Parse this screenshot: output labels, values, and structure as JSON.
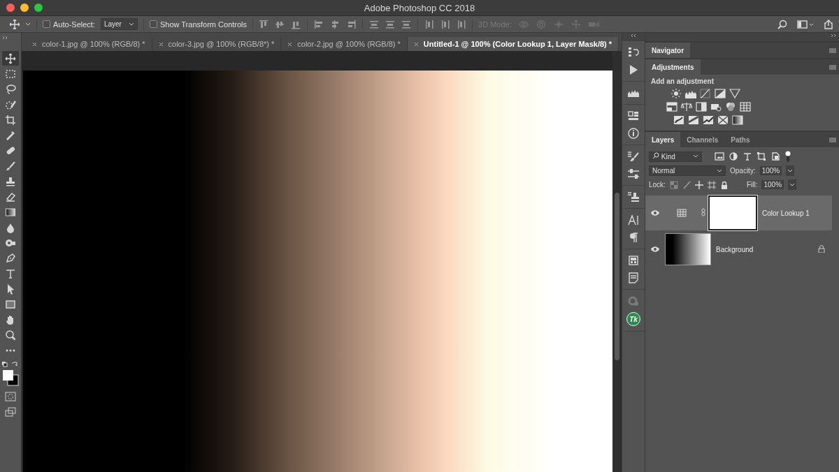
{
  "window": {
    "title": "Adobe Photoshop CC 2018"
  },
  "options_bar": {
    "auto_select": {
      "label": "Auto-Select:",
      "checked": false
    },
    "target": "Layer",
    "show_transform": {
      "label": "Show Transform Controls",
      "checked": false
    },
    "mode_3d": "3D Mode:"
  },
  "document_tabs": [
    {
      "label": "color-1.jpg @ 100% (RGB/8) *",
      "selected": false
    },
    {
      "label": "color-3.jpg @ 100% (RGB/8*) *",
      "selected": false
    },
    {
      "label": "color-2.jpg @ 100% (RGB/8) *",
      "selected": false
    },
    {
      "label": "Untitled-1 @ 100% (Color Lookup 1, Layer Mask/8) *",
      "selected": true
    }
  ],
  "tools": [
    {
      "kind": "move",
      "selected": true
    },
    {
      "kind": "marquee",
      "selected": false
    },
    {
      "kind": "lasso",
      "selected": false
    },
    {
      "kind": "quick-select",
      "selected": false
    },
    {
      "kind": "crop",
      "selected": false
    },
    {
      "kind": "eyedropper",
      "selected": false
    },
    {
      "kind": "healing",
      "selected": false
    },
    {
      "kind": "brush",
      "selected": false
    },
    {
      "kind": "stamp",
      "selected": false
    },
    {
      "kind": "eraser",
      "selected": false
    },
    {
      "kind": "gradient",
      "selected": false
    },
    {
      "kind": "blur",
      "selected": false
    },
    {
      "kind": "dodge",
      "selected": false
    },
    {
      "kind": "pen",
      "selected": false
    },
    {
      "kind": "type",
      "selected": false
    },
    {
      "kind": "path-select",
      "selected": false
    },
    {
      "kind": "rectangle",
      "selected": false
    },
    {
      "kind": "hand",
      "selected": false
    },
    {
      "kind": "zoom",
      "selected": false
    },
    {
      "kind": "more",
      "selected": false
    }
  ],
  "panels": {
    "navigator": {
      "title": "Navigator"
    },
    "adjustments": {
      "title": "Adjustments",
      "subtitle": "Add an adjustment"
    },
    "layers": {
      "tabs": [
        {
          "label": "Layers",
          "selected": true
        },
        {
          "label": "Channels",
          "selected": false
        },
        {
          "label": "Paths",
          "selected": false
        }
      ],
      "filter": "Kind",
      "blend_mode": "Normal",
      "opacity_label": "Opacity:",
      "opacity": "100%",
      "lock_label": "Lock:",
      "fill_label": "Fill:",
      "fill": "100%",
      "layers": [
        {
          "name": "Color Lookup 1",
          "kind": "adjustment",
          "visible": true,
          "selected": true,
          "locked": false
        },
        {
          "name": "Background",
          "kind": "image",
          "visible": true,
          "selected": false,
          "locked": true
        }
      ]
    }
  },
  "plugin_badge": "Tk"
}
